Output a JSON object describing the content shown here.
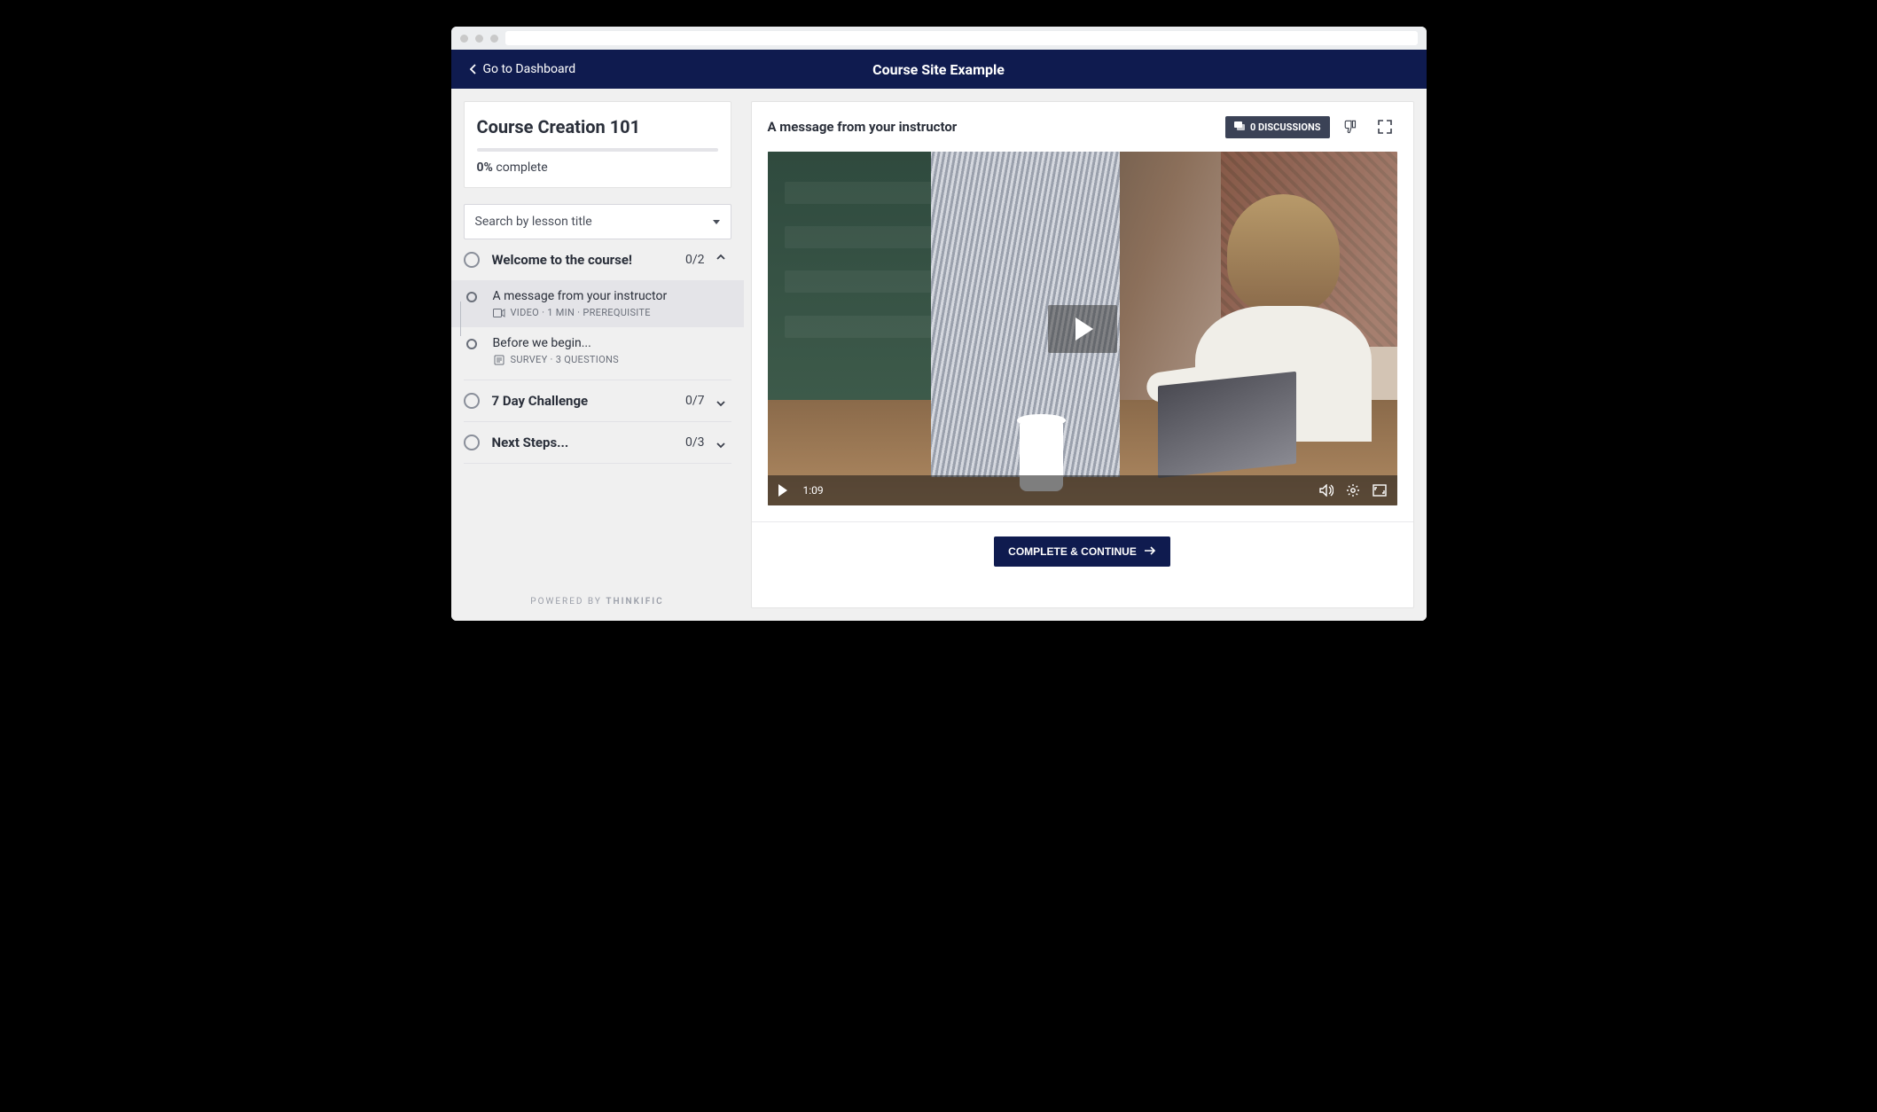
{
  "colors": {
    "brand": "#0f1b4f",
    "pill": "#3b4256"
  },
  "topnav": {
    "back_label": "Go to Dashboard",
    "site_title": "Course Site Example"
  },
  "course": {
    "title": "Course Creation 101",
    "percent": "0%",
    "complete_label": "complete"
  },
  "search": {
    "placeholder": "Search by lesson title"
  },
  "chapters": [
    {
      "title": "Welcome to the course!",
      "count": "0/2",
      "expanded": true,
      "lessons": [
        {
          "title": "A message from your instructor",
          "meta": "VIDEO · 1 MIN  ·  PREREQUISITE",
          "type": "video",
          "active": true
        },
        {
          "title": "Before we begin...",
          "meta": "SURVEY · 3 QUESTIONS",
          "type": "survey",
          "active": false
        }
      ]
    },
    {
      "title": "7 Day Challenge",
      "count": "0/7",
      "expanded": false,
      "lessons": []
    },
    {
      "title": "Next Steps...",
      "count": "0/3",
      "expanded": false,
      "lessons": []
    }
  ],
  "powered": {
    "prefix": "POWERED BY ",
    "brand": "THINKIFIC"
  },
  "content": {
    "title": "A message from your instructor",
    "discussions_label": "0 DISCUSSIONS",
    "video_time": "1:09",
    "cta": "COMPLETE & CONTINUE"
  }
}
